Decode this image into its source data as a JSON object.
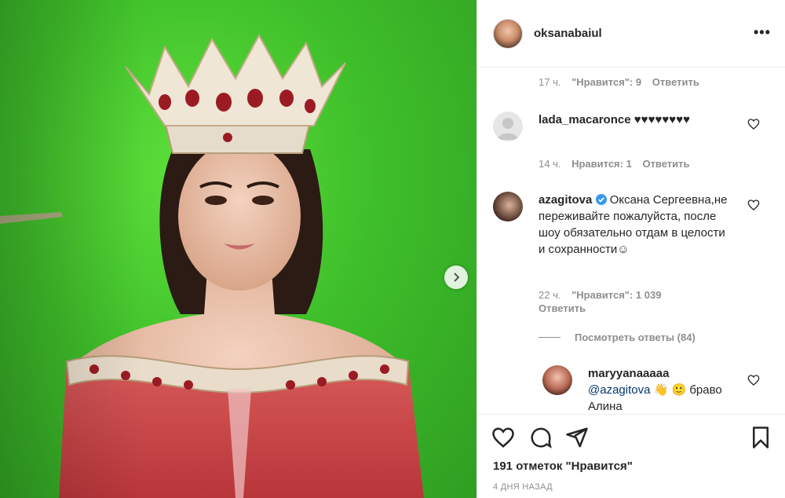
{
  "post": {
    "username": "oksanabaiul",
    "more_icon": "more-horizontal-icon"
  },
  "comments": [
    {
      "meta_time": "17 ч.",
      "meta_likes": "\"Нравится\": 9",
      "meta_reply": "Ответить"
    },
    {
      "username": "lada_macaronce",
      "text": "♥♥♥♥♥♥♥♥",
      "meta_time": "14 ч.",
      "meta_likes": "Нравится: 1",
      "meta_reply": "Ответить"
    },
    {
      "username": "azagitova",
      "verified": true,
      "text": "Оксана Сергеевна,не переживайте пожалуйста, после шоу обязательно отдам в целости и сохранности☺",
      "meta_time": "22 ч.",
      "meta_likes": "\"Нравится\": 1 039",
      "meta_reply": "Ответить",
      "view_replies": "Посмотреть ответы (84)"
    },
    {
      "username": "maryyanaaaaa",
      "mention": "@azagitova",
      "text": "👋 🙂 браво Алина"
    }
  ],
  "footer": {
    "likes": "191 отметок \"Нравится\"",
    "date": "4 ДНЯ НАЗАД"
  },
  "colors": {
    "text": "#262626",
    "secondary": "#8e8e8e",
    "link": "#00376b",
    "verified": "#3897f0",
    "green_screen": "#3fbf2a"
  }
}
